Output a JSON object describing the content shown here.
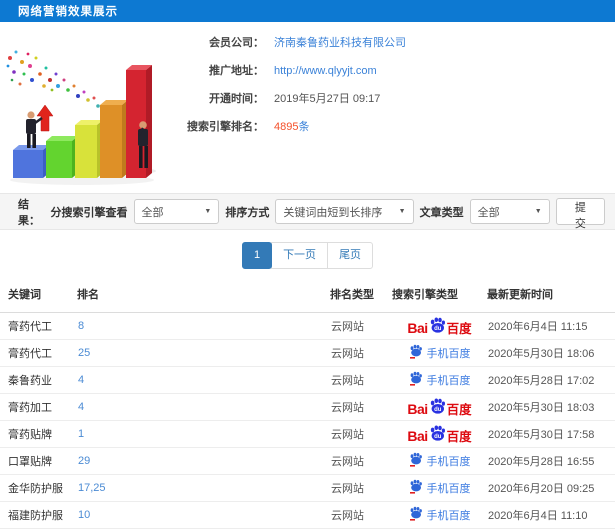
{
  "title_bar": {
    "title": "网络营销效果展示"
  },
  "member_info": {
    "company_label": "会员公司：",
    "company_value": "济南秦鲁药业科技有限公司",
    "url_label": "推广地址：",
    "url_value": "http://www.qlyyjt.com",
    "open_time_label": "开通时间：",
    "open_time_value": "2019年5月27日 09:17",
    "rank_label": "搜索引擎排名：",
    "rank_count": "4895",
    "rank_unit": "条"
  },
  "filter_bar": {
    "result_label": "结果：",
    "engine_filter_label": "分搜索引擎查看",
    "engine_filter_value": "全部",
    "sort_label": "排序方式",
    "sort_value": "关键词由短到长排序",
    "article_type_label": "文章类型",
    "article_type_value": "全部",
    "submit_label": "提交",
    "caret": "▼"
  },
  "pagination": {
    "current_page": "1",
    "next_label": "下一页",
    "last_label": "尾页"
  },
  "table": {
    "headers": [
      "关键词",
      "排名",
      "排名类型",
      "搜索引擎类型",
      "最新更新时间"
    ],
    "rows": [
      {
        "keyword": "膏药代工",
        "rank": "8",
        "rank_type": "云网站",
        "engine": "baidu",
        "updated": "2020年6月4日 11:15"
      },
      {
        "keyword": "膏药代工",
        "rank": "25",
        "rank_type": "云网站",
        "engine": "mobile-baidu",
        "updated": "2020年5月30日 18:06"
      },
      {
        "keyword": "秦鲁药业",
        "rank": "4",
        "rank_type": "云网站",
        "engine": "mobile-baidu",
        "updated": "2020年5月28日 17:02"
      },
      {
        "keyword": "膏药加工",
        "rank": "4",
        "rank_type": "云网站",
        "engine": "baidu",
        "updated": "2020年5月30日 18:03"
      },
      {
        "keyword": "膏药贴牌",
        "rank": "1",
        "rank_type": "云网站",
        "engine": "baidu",
        "updated": "2020年5月30日 17:58"
      },
      {
        "keyword": "口罩贴牌",
        "rank": "29",
        "rank_type": "云网站",
        "engine": "mobile-baidu",
        "updated": "2020年5月28日 16:55"
      },
      {
        "keyword": "金华防护服",
        "rank": "17,25",
        "rank_type": "云网站",
        "engine": "mobile-baidu",
        "updated": "2020年6月20日 09:25"
      },
      {
        "keyword": "福建防护服",
        "rank": "10",
        "rank_type": "云网站",
        "engine": "mobile-baidu",
        "updated": "2020年6月4日 11:10"
      }
    ]
  },
  "engines": {
    "baidu": {
      "prefix": "Bai",
      "paw_text": "du",
      "suffix": "百度"
    },
    "mobile_baidu": {
      "label": "手机百度"
    }
  },
  "colors": {
    "header_blue": "#0d79d2",
    "link_blue": "#3b82d8",
    "rank_red": "#f4502a",
    "baidu_red": "#dd0a10",
    "baidu_blue": "#2932e1",
    "mobile_baidu_blue": "#3b7ae0",
    "pagination_blue": "#337ab7",
    "filter_bg": "#f5f5f5"
  }
}
